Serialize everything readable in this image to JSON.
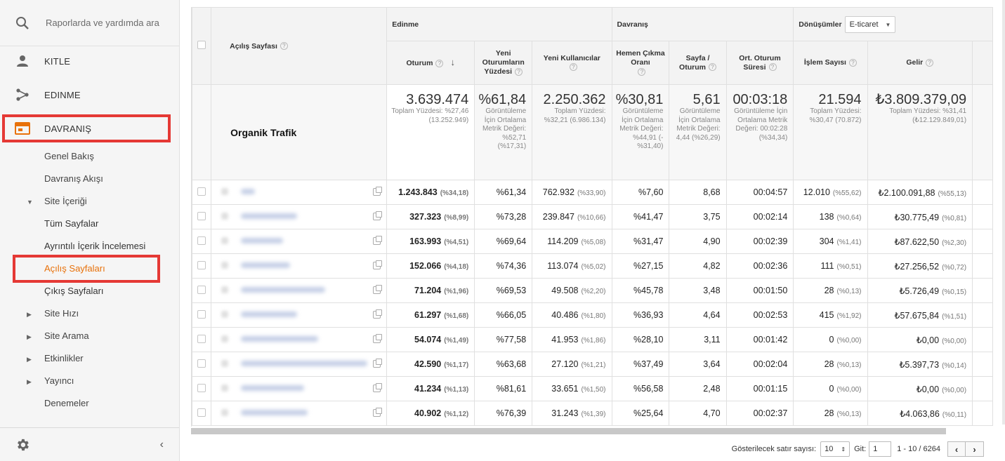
{
  "sidebar": {
    "search_placeholder": "Raporlarda ve yardımda ara",
    "main_items": [
      {
        "label": "KITLE",
        "icon": "person-icon"
      },
      {
        "label": "EDINME",
        "icon": "acquisition-icon"
      },
      {
        "label": "DAVRANIŞ",
        "icon": "behavior-icon"
      }
    ],
    "sub_items": [
      {
        "label": "Genel Bakış"
      },
      {
        "label": "Davranış Akışı"
      },
      {
        "label": "Site İçeriği",
        "expanded": true
      },
      {
        "label": "Tüm Sayfalar"
      },
      {
        "label": "Ayrıntılı İçerik İncelemesi"
      },
      {
        "label": "Açılış Sayfaları",
        "active": true
      },
      {
        "label": "Çıkış Sayfaları"
      },
      {
        "label": "Site Hızı"
      },
      {
        "label": "Site Arama"
      },
      {
        "label": "Etkinlikler"
      },
      {
        "label": "Yayıncı"
      },
      {
        "label": "Denemeler"
      }
    ],
    "accent_color": "#e8710a",
    "highlight_color": "#e53935"
  },
  "table": {
    "col_landing_page": "Açılış Sayfası",
    "group_acquisition": "Edinme",
    "group_behavior": "Davranış",
    "group_conversions": "Dönüşümler",
    "conversion_select": "E-ticaret",
    "columns": {
      "sessions": "Oturum",
      "new_sessions_pct": "Yeni Oturumların Yüzdesi",
      "new_users": "Yeni Kullanıcılar",
      "bounce_rate": "Hemen Çıkma Oranı",
      "pages_per_session": "Sayfa / Oturum",
      "avg_duration": "Ort. Oturum Süresi",
      "transactions": "İşlem Sayısı",
      "revenue": "Gelir"
    },
    "segment_label": "Organik Trafik",
    "totals": {
      "sessions": {
        "value": "3.639.474",
        "sub": "Toplam Yüzdesi: %27,46 (13.252.949)"
      },
      "new_sessions_pct": {
        "value": "%61,84",
        "sub": "Görüntüleme İçin Ortalama Metrik Değeri: %52,71 (%17,31)"
      },
      "new_users": {
        "value": "2.250.362",
        "sub": "Toplam Yüzdesi: %32,21 (6.986.134)"
      },
      "bounce_rate": {
        "value": "%30,81",
        "sub": "Görüntüleme İçin Ortalama Metrik Değeri: %44,91 (-%31,40)"
      },
      "pages_per_session": {
        "value": "5,61",
        "sub": "Görüntüleme İçin Ortalama Metrik Değeri: 4,44 (%26,29)"
      },
      "avg_duration": {
        "value": "00:03:18",
        "sub": "Görüntüleme İçin Ortalama Metrik Değeri: 00:02:28 (%34,34)"
      },
      "transactions": {
        "value": "21.594",
        "sub": "Toplam Yüzdesi: %30,47 (70.872)"
      },
      "revenue": {
        "value": "₺3.809.379,09",
        "sub": "Toplam Yüzdesi: %31,41 (₺12.129.849,01)"
      }
    },
    "rows": [
      {
        "sessions": "1.243.843",
        "sessions_pct": "(%34,18)",
        "new_pct": "%61,34",
        "new_users": "762.932",
        "new_users_pct": "(%33,90)",
        "bounce": "%7,60",
        "pps": "8,68",
        "dur": "00:04:57",
        "tx": "12.010",
        "tx_pct": "(%55,62)",
        "rev": "₺2.100.091,88",
        "rev_pct": "(%55,13)"
      },
      {
        "sessions": "327.323",
        "sessions_pct": "(%8,99)",
        "new_pct": "%73,28",
        "new_users": "239.847",
        "new_users_pct": "(%10,66)",
        "bounce": "%41,47",
        "pps": "3,75",
        "dur": "00:02:14",
        "tx": "138",
        "tx_pct": "(%0,64)",
        "rev": "₺30.775,49",
        "rev_pct": "(%0,81)"
      },
      {
        "sessions": "163.993",
        "sessions_pct": "(%4,51)",
        "new_pct": "%69,64",
        "new_users": "114.209",
        "new_users_pct": "(%5,08)",
        "bounce": "%31,47",
        "pps": "4,90",
        "dur": "00:02:39",
        "tx": "304",
        "tx_pct": "(%1,41)",
        "rev": "₺87.622,50",
        "rev_pct": "(%2,30)"
      },
      {
        "sessions": "152.066",
        "sessions_pct": "(%4,18)",
        "new_pct": "%74,36",
        "new_users": "113.074",
        "new_users_pct": "(%5,02)",
        "bounce": "%27,15",
        "pps": "4,82",
        "dur": "00:02:36",
        "tx": "111",
        "tx_pct": "(%0,51)",
        "rev": "₺27.256,52",
        "rev_pct": "(%0,72)"
      },
      {
        "sessions": "71.204",
        "sessions_pct": "(%1,96)",
        "new_pct": "%69,53",
        "new_users": "49.508",
        "new_users_pct": "(%2,20)",
        "bounce": "%45,78",
        "pps": "3,48",
        "dur": "00:01:50",
        "tx": "28",
        "tx_pct": "(%0,13)",
        "rev": "₺5.726,49",
        "rev_pct": "(%0,15)"
      },
      {
        "sessions": "61.297",
        "sessions_pct": "(%1,68)",
        "new_pct": "%66,05",
        "new_users": "40.486",
        "new_users_pct": "(%1,80)",
        "bounce": "%36,93",
        "pps": "4,64",
        "dur": "00:02:53",
        "tx": "415",
        "tx_pct": "(%1,92)",
        "rev": "₺57.675,84",
        "rev_pct": "(%1,51)"
      },
      {
        "sessions": "54.074",
        "sessions_pct": "(%1,49)",
        "new_pct": "%77,58",
        "new_users": "41.953",
        "new_users_pct": "(%1,86)",
        "bounce": "%28,10",
        "pps": "3,11",
        "dur": "00:01:42",
        "tx": "0",
        "tx_pct": "(%0,00)",
        "rev": "₺0,00",
        "rev_pct": "(%0,00)"
      },
      {
        "sessions": "42.590",
        "sessions_pct": "(%1,17)",
        "new_pct": "%63,68",
        "new_users": "27.120",
        "new_users_pct": "(%1,21)",
        "bounce": "%37,49",
        "pps": "3,64",
        "dur": "00:02:04",
        "tx": "28",
        "tx_pct": "(%0,13)",
        "rev": "₺5.397,73",
        "rev_pct": "(%0,14)"
      },
      {
        "sessions": "41.234",
        "sessions_pct": "(%1,13)",
        "new_pct": "%81,61",
        "new_users": "33.651",
        "new_users_pct": "(%1,50)",
        "bounce": "%56,58",
        "pps": "2,48",
        "dur": "00:01:15",
        "tx": "0",
        "tx_pct": "(%0,00)",
        "rev": "₺0,00",
        "rev_pct": "(%0,00)"
      },
      {
        "sessions": "40.902",
        "sessions_pct": "(%1,12)",
        "new_pct": "%76,39",
        "new_users": "31.243",
        "new_users_pct": "(%1,39)",
        "bounce": "%25,64",
        "pps": "4,70",
        "dur": "00:02:37",
        "tx": "28",
        "tx_pct": "(%0,13)",
        "rev": "₺4.063,86",
        "rev_pct": "(%0,11)"
      }
    ]
  },
  "pagination": {
    "rows_label": "Gösterilecek satır sayısı:",
    "rows_value": "10",
    "goto_label": "Git:",
    "goto_value": "1",
    "range": "1 - 10 / 6264"
  }
}
